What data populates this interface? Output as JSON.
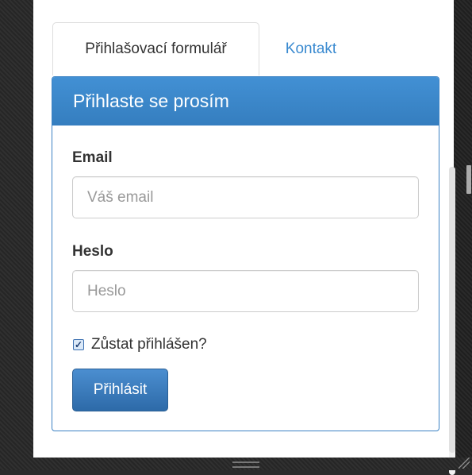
{
  "tabs": [
    {
      "label": "Přihlašovací formulář",
      "active": true
    },
    {
      "label": "Kontakt",
      "active": false
    }
  ],
  "panel": {
    "heading": "Přihlaste se prosím"
  },
  "form": {
    "email_label": "Email",
    "email_placeholder": "Váš email",
    "email_value": "",
    "password_label": "Heslo",
    "password_placeholder": "Heslo",
    "password_value": "",
    "remember_label": "Zůstat přihlášen?",
    "remember_checked": true,
    "submit_label": "Přihlásit"
  },
  "colors": {
    "accent": "#357ebf",
    "link": "#3a8ad0",
    "background": "#2b2b2b"
  }
}
